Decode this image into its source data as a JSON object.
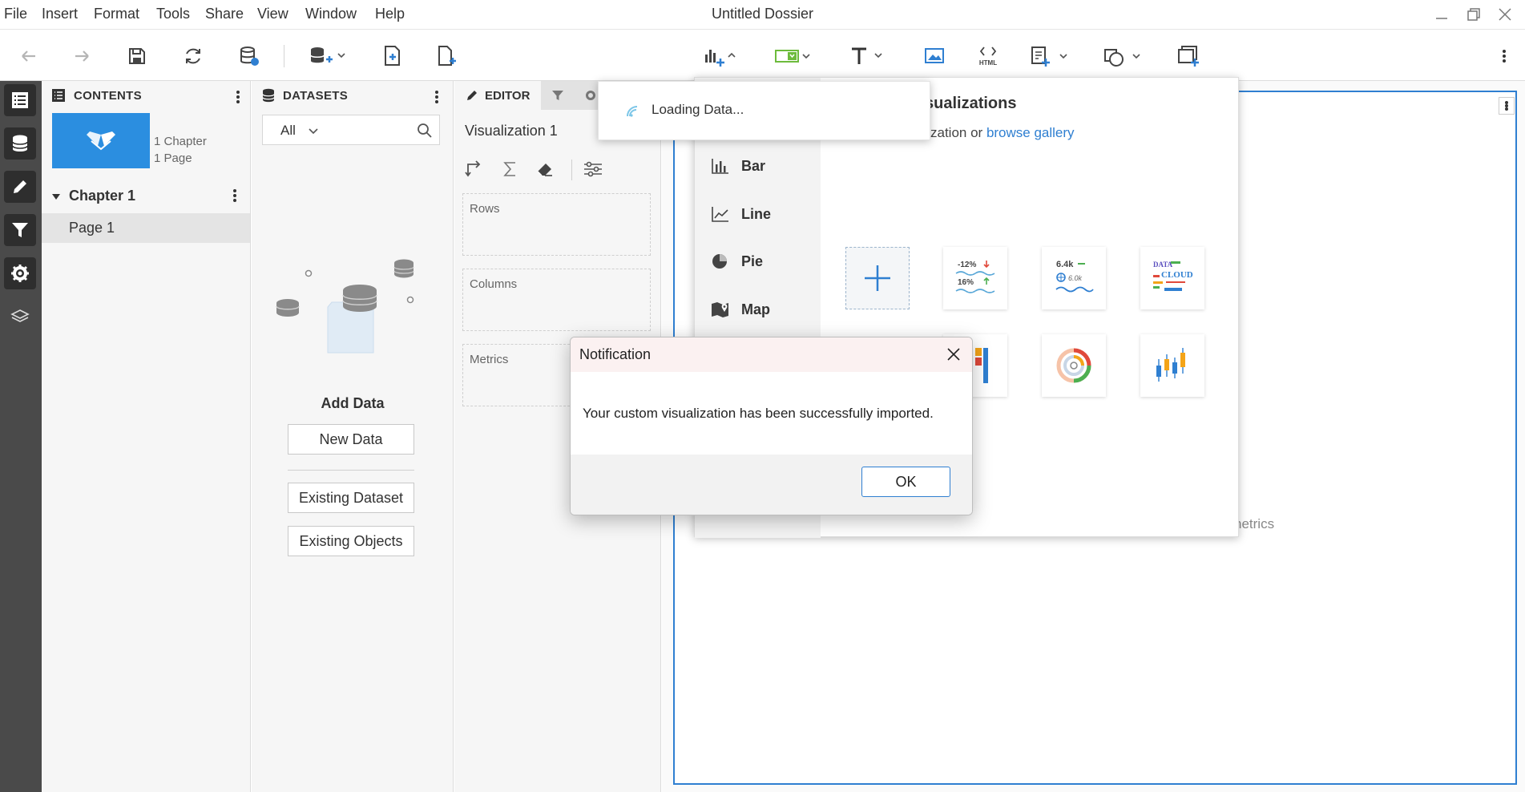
{
  "menubar": {
    "items": [
      "File",
      "Insert",
      "Format",
      "Tools",
      "Share",
      "View",
      "Window",
      "Help"
    ],
    "window_title": "Untitled Dossier"
  },
  "contents": {
    "header": "CONTENTS",
    "summary_chapters": "1 Chapter",
    "summary_pages": "1 Page",
    "chapter_label": "Chapter 1",
    "page_label": "Page 1"
  },
  "datasets": {
    "header": "DATASETS",
    "filter_value": "All",
    "add_data_label": "Add Data",
    "new_data": "New Data",
    "existing_dataset": "Existing Dataset",
    "existing_objects": "Existing Objects"
  },
  "editor": {
    "tab_label": "EDITOR",
    "viz_name": "Visualization 1",
    "zones": [
      "Rows",
      "Columns",
      "Metrics"
    ]
  },
  "gallery": {
    "title_partial": "sualizations",
    "subtitle_partial": "zation or ",
    "browse_link": "browse gallery",
    "categories": [
      "Bar",
      "Line",
      "Pie",
      "Map"
    ],
    "kpi_tile": {
      "delta_neg": "-12%",
      "delta_pos": "16%"
    },
    "number_tile": {
      "main": "6.4k",
      "sub": "6.0k"
    },
    "cloud_tile": {
      "line1": "DATA",
      "line2": "CLOUD"
    }
  },
  "canvas": {
    "hint_partial": "netrics"
  },
  "loading": {
    "text": "Loading Data..."
  },
  "dialog": {
    "title": "Notification",
    "message": "Your custom visualization has been successfully imported.",
    "ok_label": "OK"
  },
  "colors": {
    "accent_blue": "#2f7fd1",
    "rail_bg": "#4a4a4a",
    "panel_bg": "#f6f6f6",
    "dialog_header": "#fbf1f1"
  }
}
